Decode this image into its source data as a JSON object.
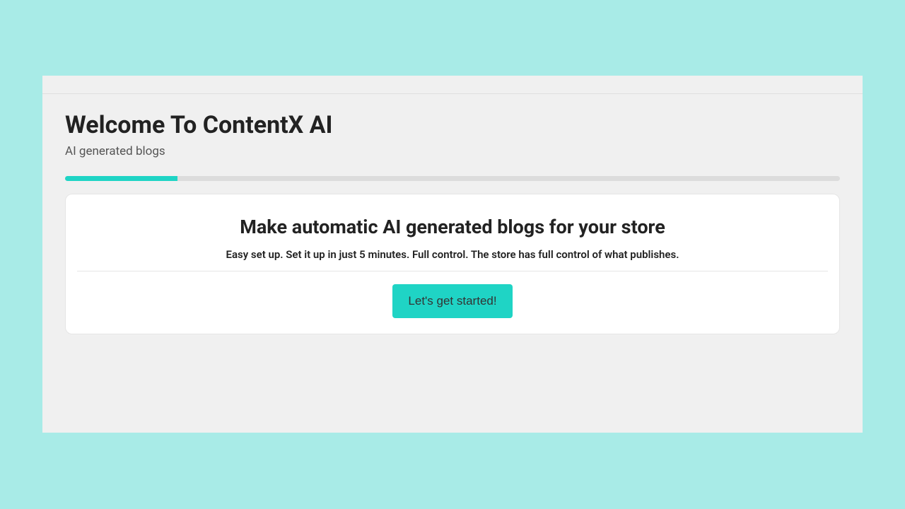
{
  "header": {
    "title": "Welcome To ContentX AI",
    "subtitle": "AI generated blogs"
  },
  "progress": {
    "percent": 14.5
  },
  "card": {
    "heading": "Make automatic AI generated blogs for your store",
    "description": "Easy set up. Set it up in just 5 minutes. Full control. The store has full control of what publishes.",
    "cta_label": "Let's get started!"
  },
  "colors": {
    "accent": "#1fd4c5",
    "page_bg": "#a8ebe7",
    "panel_bg": "#f0f0f0"
  }
}
